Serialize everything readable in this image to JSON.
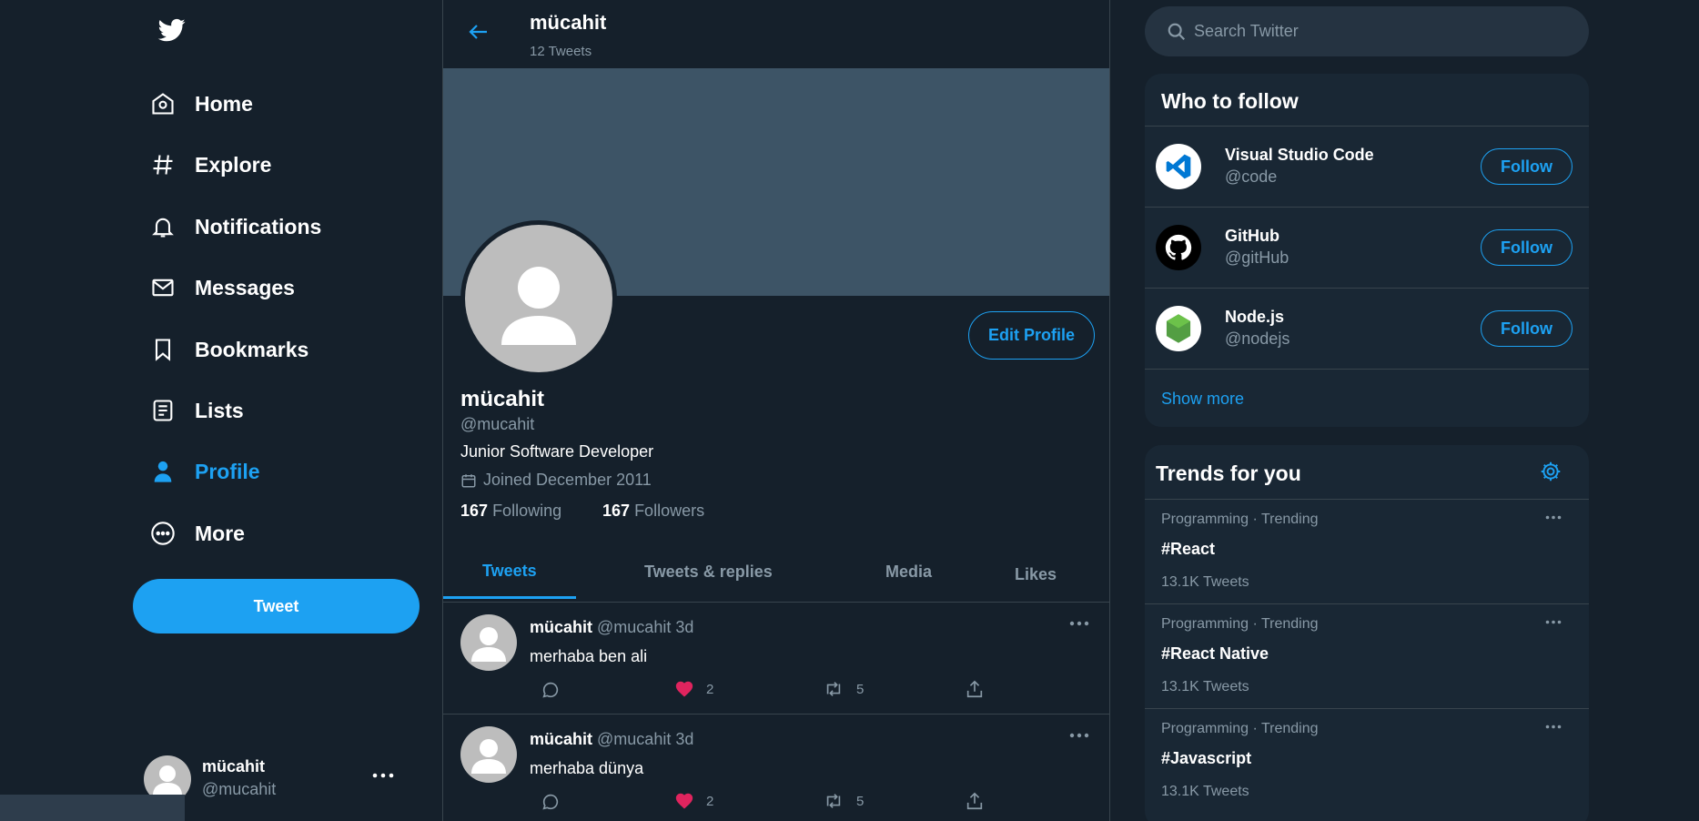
{
  "nav": {
    "items": [
      {
        "label": "Home",
        "icon": "home-icon"
      },
      {
        "label": "Explore",
        "icon": "hashtag-icon"
      },
      {
        "label": "Notifications",
        "icon": "bell-icon"
      },
      {
        "label": "Messages",
        "icon": "mail-icon"
      },
      {
        "label": "Bookmarks",
        "icon": "bookmark-icon"
      },
      {
        "label": "Lists",
        "icon": "list-icon"
      },
      {
        "label": "Profile",
        "icon": "person-icon",
        "active": true
      },
      {
        "label": "More",
        "icon": "more-circle-icon"
      }
    ],
    "tweet_button": "Tweet",
    "account": {
      "name": "mücahit",
      "handle": "@mucahit"
    }
  },
  "header": {
    "title": "mücahit",
    "tweet_count": "12 Tweets"
  },
  "profile": {
    "edit_button": "Edit Profile",
    "name": "mücahit",
    "handle": "@mucahit",
    "bio": "Junior Software Developer",
    "joined": "Joined December 2011",
    "following_count": "167",
    "following_label": "Following",
    "followers_count": "167",
    "followers_label": "Followers"
  },
  "tabs": [
    "Tweets",
    "Tweets & replies",
    "Media",
    "Likes"
  ],
  "tweets": [
    {
      "name": "mücahit",
      "handle": "@mucahit",
      "time": "3d",
      "text": "merhaba ben ali",
      "likes": "2",
      "retweets": "5"
    },
    {
      "name": "mücahit",
      "handle": "@mucahit",
      "time": "3d",
      "text": "merhaba dünya",
      "likes": "2",
      "retweets": "5"
    }
  ],
  "search": {
    "placeholder": "Search Twitter"
  },
  "who_to_follow": {
    "title": "Who to follow",
    "items": [
      {
        "name": "Visual Studio Code",
        "handle": "@code",
        "button": "Follow"
      },
      {
        "name": "GitHub",
        "handle": "@gitHub",
        "button": "Follow"
      },
      {
        "name": "Node.js",
        "handle": "@nodejs",
        "button": "Follow"
      }
    ],
    "show_more": "Show more"
  },
  "trends": {
    "title": "Trends for you",
    "items": [
      {
        "context": "Programming · Trending",
        "tag": "#React",
        "count": "13.1K Tweets"
      },
      {
        "context": "Programming · Trending",
        "tag": "#React Native",
        "count": "13.1K Tweets"
      },
      {
        "context": "Programming · Trending",
        "tag": "#Javascript",
        "count": "13.1K Tweets"
      }
    ]
  },
  "colors": {
    "background": "#15202b",
    "accent": "#1da1f2",
    "panel": "#192734",
    "like": "#e0245e",
    "banner": "#3d5466"
  }
}
